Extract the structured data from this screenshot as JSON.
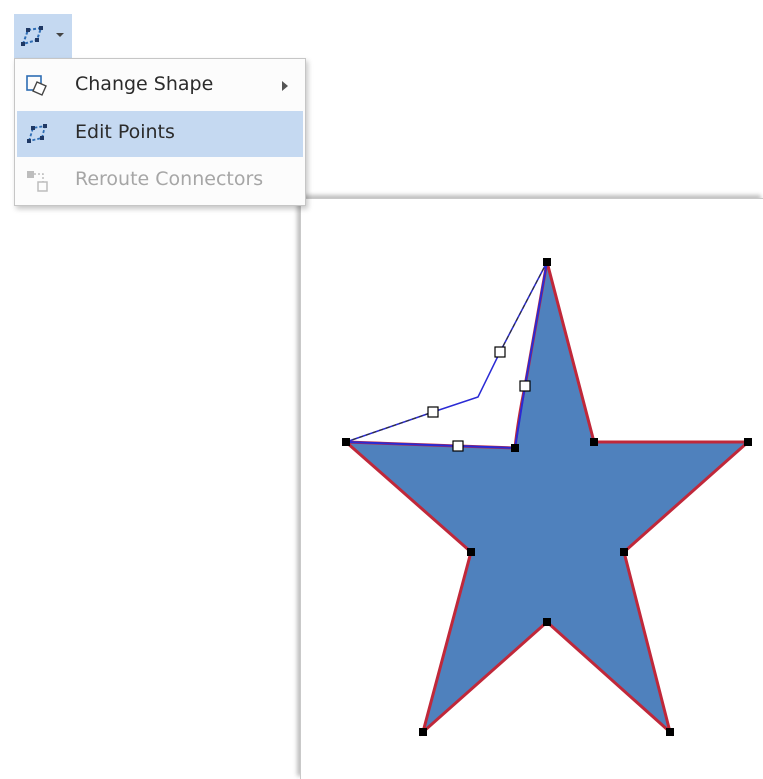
{
  "ribbon": {
    "edit_shape_icon": "edit-shape-icon"
  },
  "menu": {
    "items": [
      {
        "label": "Change Shape",
        "icon": "change-shape-icon",
        "has_submenu": true,
        "state": "normal"
      },
      {
        "label": "Edit Points",
        "icon": "edit-points-icon",
        "has_submenu": false,
        "state": "highlighted"
      },
      {
        "label": "Reroute Connectors",
        "icon": "reroute-connectors-icon",
        "has_submenu": false,
        "state": "disabled"
      }
    ]
  },
  "shape": {
    "type": "five-point-star",
    "fill_color": "#4f81bd",
    "outline_color": "#c0283a",
    "edited_segment_color": "#2a2ad4",
    "mode": "edit-points"
  },
  "colors": {
    "highlight": "#c5d9f1",
    "disabled_text": "#a6a6a6"
  }
}
